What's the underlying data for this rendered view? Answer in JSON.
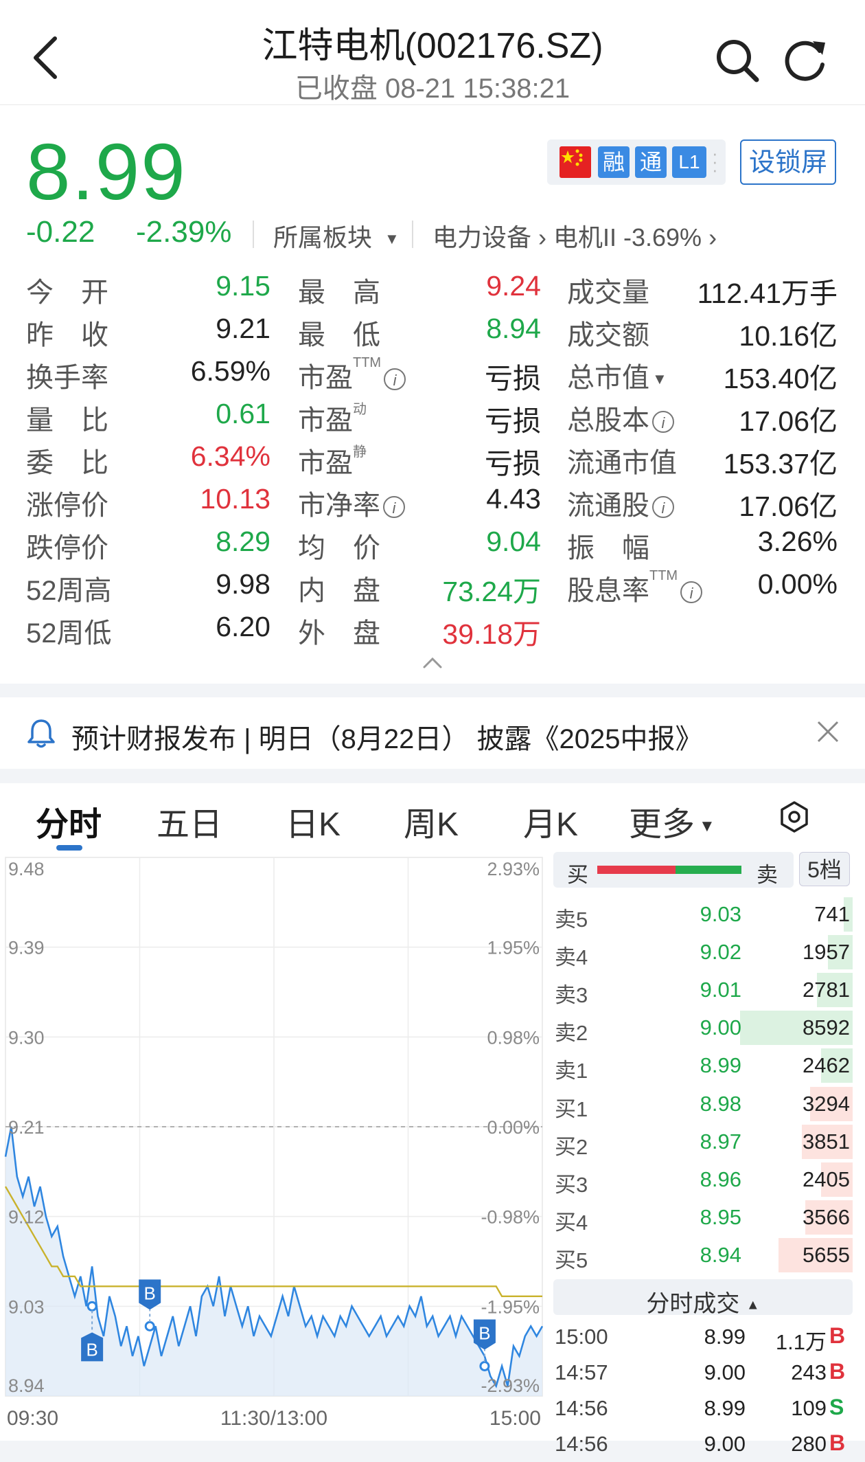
{
  "header": {
    "title": "江特电机(002176.SZ)",
    "subtitle": "已收盘 08-21 15:38:21"
  },
  "quote": {
    "price": "8.99",
    "change": "-0.22",
    "change_pct": "-2.39%",
    "sector_label": "所属板块",
    "sector_path": "电力设备 › 电机II -3.69% ›",
    "badges": [
      "融",
      "通",
      "L1"
    ],
    "lock_button": "设锁屏"
  },
  "stats": {
    "col1": [
      {
        "label": "今　开",
        "value": "9.15"
      },
      {
        "label": "昨　收",
        "value": "9.21"
      },
      {
        "label": "换手率",
        "value": "6.59%"
      },
      {
        "label": "量　比",
        "value": "0.61"
      },
      {
        "label": "委　比",
        "value": "6.34%"
      },
      {
        "label": "涨停价",
        "value": "10.13"
      },
      {
        "label": "跌停价",
        "value": "8.29"
      },
      {
        "label": "52周高",
        "value": "9.98"
      },
      {
        "label": "52周低",
        "value": "6.20"
      }
    ],
    "col2": [
      {
        "label": "最　高",
        "value": "9.24"
      },
      {
        "label": "最　低",
        "value": "8.94"
      },
      {
        "label": "市盈",
        "sup": "TTM",
        "value": "亏损"
      },
      {
        "label": "市盈",
        "sup": "动",
        "value": "亏损"
      },
      {
        "label": "市盈",
        "sup": "静",
        "value": "亏损"
      },
      {
        "label": "市净率",
        "value": "4.43"
      },
      {
        "label": "均　价",
        "value": "9.04"
      },
      {
        "label": "内　盘",
        "value": "73.24万"
      },
      {
        "label": "外　盘",
        "value": "39.18万"
      }
    ],
    "col3": [
      {
        "label": "成交量",
        "value": "112.41万手"
      },
      {
        "label": "成交额",
        "value": "10.16亿"
      },
      {
        "label": "总市值",
        "value": "153.40亿"
      },
      {
        "label": "总股本",
        "value": "17.06亿"
      },
      {
        "label": "流通市值",
        "value": "153.37亿"
      },
      {
        "label": "流通股",
        "value": "17.06亿"
      },
      {
        "label": "振　幅",
        "value": "3.26%"
      },
      {
        "label": "股息率",
        "sup": "TTM",
        "value": "0.00%"
      }
    ]
  },
  "notice": {
    "text": "预计财报发布 | 明日（8月22日） 披露《2025中报》"
  },
  "tabs": [
    "分时",
    "五日",
    "日K",
    "周K",
    "月K",
    "更多"
  ],
  "chart_data": {
    "type": "line",
    "x_labels": [
      "09:30",
      "11:30/13:00",
      "15:00"
    ],
    "y_left_ticks": [
      "9.48",
      "9.39",
      "9.30",
      "9.21",
      "9.12",
      "9.03",
      "8.94"
    ],
    "y_right_ticks": [
      "2.93%",
      "1.95%",
      "0.98%",
      "0.00%",
      "-0.98%",
      "-1.95%",
      "-2.93%"
    ],
    "ylim": [
      8.94,
      9.48
    ],
    "prev_close": 9.21,
    "series": [
      {
        "values": [
          9.18,
          9.21,
          9.16,
          9.14,
          9.16,
          9.13,
          9.15,
          9.12,
          9.1,
          9.11,
          9.08,
          9.06,
          9.04,
          9.06,
          9.03,
          9.07,
          9.02,
          9.0,
          9.04,
          9.02,
          8.99,
          9.01,
          8.98,
          9.0,
          8.97,
          8.99,
          9.01,
          8.98,
          9.0,
          9.02,
          8.99,
          9.01,
          9.03,
          9.0,
          9.04,
          9.05,
          9.03,
          9.06,
          9.02,
          9.05,
          9.03,
          9.01,
          9.03,
          9.0,
          9.02,
          9.01,
          9.0,
          9.02,
          9.04,
          9.02,
          9.05,
          9.03,
          9.01,
          9.02,
          9.0,
          9.02,
          9.01,
          9.0,
          9.02,
          9.01,
          9.03,
          9.02,
          9.01,
          9.0,
          9.01,
          9.02,
          9.0,
          9.01,
          9.02,
          9.01,
          9.03,
          9.02,
          9.04,
          9.01,
          9.02,
          9.0,
          9.01,
          9.02,
          9.0,
          9.02,
          9.01,
          9.0,
          8.99,
          8.98,
          8.96,
          8.95,
          8.97,
          8.95,
          8.99,
          8.98,
          9.0,
          9.01,
          9.0,
          9.01
        ]
      },
      {
        "values": [
          9.15,
          9.14,
          9.13,
          9.12,
          9.11,
          9.1,
          9.09,
          9.08,
          9.07,
          9.07,
          9.06,
          9.06,
          9.06,
          9.05,
          9.05,
          9.05,
          9.05,
          9.05,
          9.05,
          9.05,
          9.05,
          9.05,
          9.05,
          9.05,
          9.05,
          9.05,
          9.05,
          9.05,
          9.05,
          9.05,
          9.05,
          9.05,
          9.05,
          9.05,
          9.05,
          9.05,
          9.05,
          9.05,
          9.05,
          9.05,
          9.05,
          9.05,
          9.05,
          9.05,
          9.05,
          9.05,
          9.05,
          9.05,
          9.05,
          9.05,
          9.05,
          9.05,
          9.05,
          9.05,
          9.05,
          9.05,
          9.05,
          9.05,
          9.05,
          9.05,
          9.05,
          9.05,
          9.05,
          9.05,
          9.05,
          9.05,
          9.05,
          9.05,
          9.05,
          9.05,
          9.05,
          9.05,
          9.05,
          9.05,
          9.05,
          9.05,
          9.05,
          9.05,
          9.05,
          9.05,
          9.05,
          9.05,
          9.05,
          9.05,
          9.05,
          9.05,
          9.04,
          9.04,
          9.04,
          9.04,
          9.04,
          9.04,
          9.04,
          9.04
        ]
      }
    ],
    "markers": [
      {
        "label": "B",
        "index": 15,
        "value": 9.03
      },
      {
        "label": "B",
        "index": 25,
        "value": 9.01
      },
      {
        "label": "B",
        "index": 83,
        "value": 8.97
      }
    ]
  },
  "order_book": {
    "buy_label": "买",
    "sell_label": "卖",
    "levels_button": "5档",
    "asks": [
      {
        "name": "卖5",
        "price": "9.03",
        "vol": "741",
        "depth": 0.08
      },
      {
        "name": "卖4",
        "price": "9.02",
        "vol": "1957",
        "depth": 0.22
      },
      {
        "name": "卖3",
        "price": "9.01",
        "vol": "2781",
        "depth": 0.32
      },
      {
        "name": "卖2",
        "price": "9.00",
        "vol": "8592",
        "depth": 1.0
      },
      {
        "name": "卖1",
        "price": "8.99",
        "vol": "2462",
        "depth": 0.28
      }
    ],
    "bids": [
      {
        "name": "买1",
        "price": "8.98",
        "vol": "3294",
        "depth": 0.38
      },
      {
        "name": "买2",
        "price": "8.97",
        "vol": "3851",
        "depth": 0.45
      },
      {
        "name": "买3",
        "price": "8.96",
        "vol": "2405",
        "depth": 0.28
      },
      {
        "name": "买4",
        "price": "8.95",
        "vol": "3566",
        "depth": 0.42
      },
      {
        "name": "买5",
        "price": "8.94",
        "vol": "5655",
        "depth": 0.66
      }
    ],
    "ticks_title": "分时成交",
    "ticks": [
      {
        "time": "15:00",
        "price": "8.99",
        "vol": "1.1万",
        "side": "B"
      },
      {
        "time": "14:57",
        "price": "9.00",
        "vol": "243",
        "side": "B"
      },
      {
        "time": "14:56",
        "price": "8.99",
        "vol": "109",
        "side": "S"
      },
      {
        "time": "14:56",
        "price": "9.00",
        "vol": "280",
        "side": "B"
      }
    ]
  },
  "colors": {
    "up": "#e0323c",
    "down": "#1ea84a",
    "accent": "#2c74c9",
    "price_line": "#2f86e0",
    "avg_line": "#c9b22c"
  }
}
